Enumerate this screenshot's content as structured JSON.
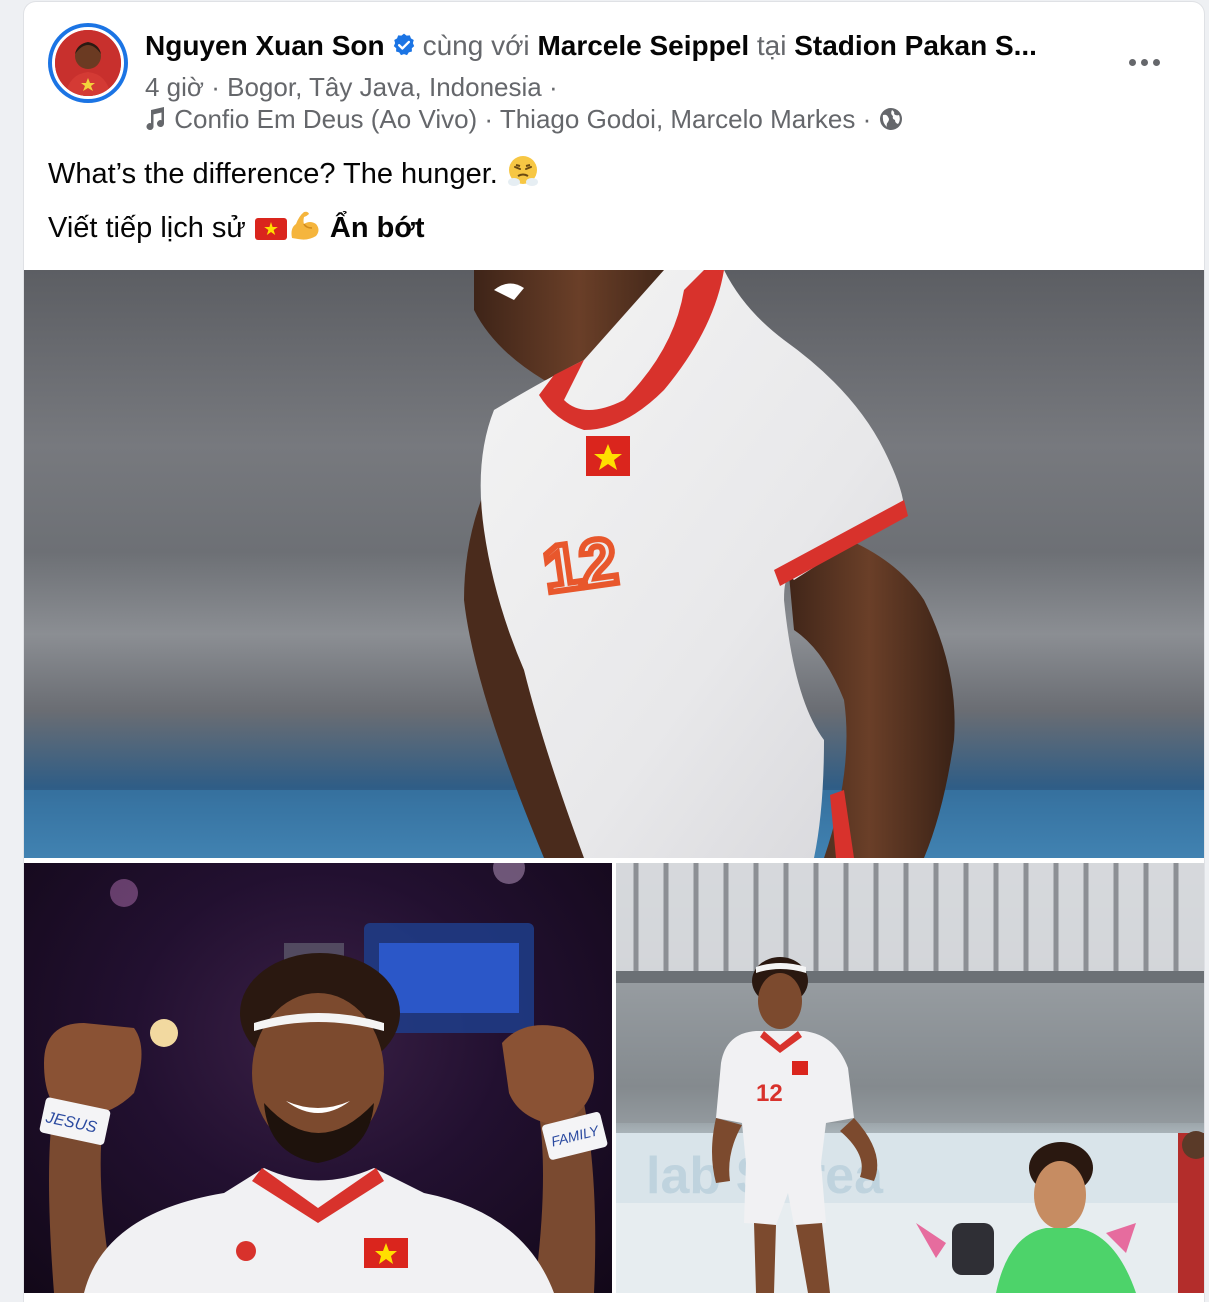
{
  "post": {
    "author": "Nguyen Xuan Son",
    "with_word": "cùng với",
    "tagged_person": "Marcele Seippel",
    "at_word": "tại",
    "place": "Stadion Pakan S...",
    "time": "4 giờ",
    "separator": "·",
    "location": "Bogor, Tây Java, Indonesia",
    "music": "Confio Em Deus (Ao Vivo) · Thiago Godoi, Marcelo Markes",
    "text_line1": "What’s the difference? The hunger.",
    "text_line2": "Viết tiếp lịch sử",
    "see_less": "Ẩn bớt",
    "privacy_icon": "globe-icon",
    "colors": {
      "verified": "#1b74e4",
      "text": "#050505",
      "secondary_text": "#65676b"
    }
  },
  "photos": {
    "main": {
      "shirt_number": "12"
    },
    "right": {
      "shirt_number": "12"
    },
    "left": {
      "wristband_left": "JESUS",
      "wristband_right": "FAMILY"
    }
  }
}
